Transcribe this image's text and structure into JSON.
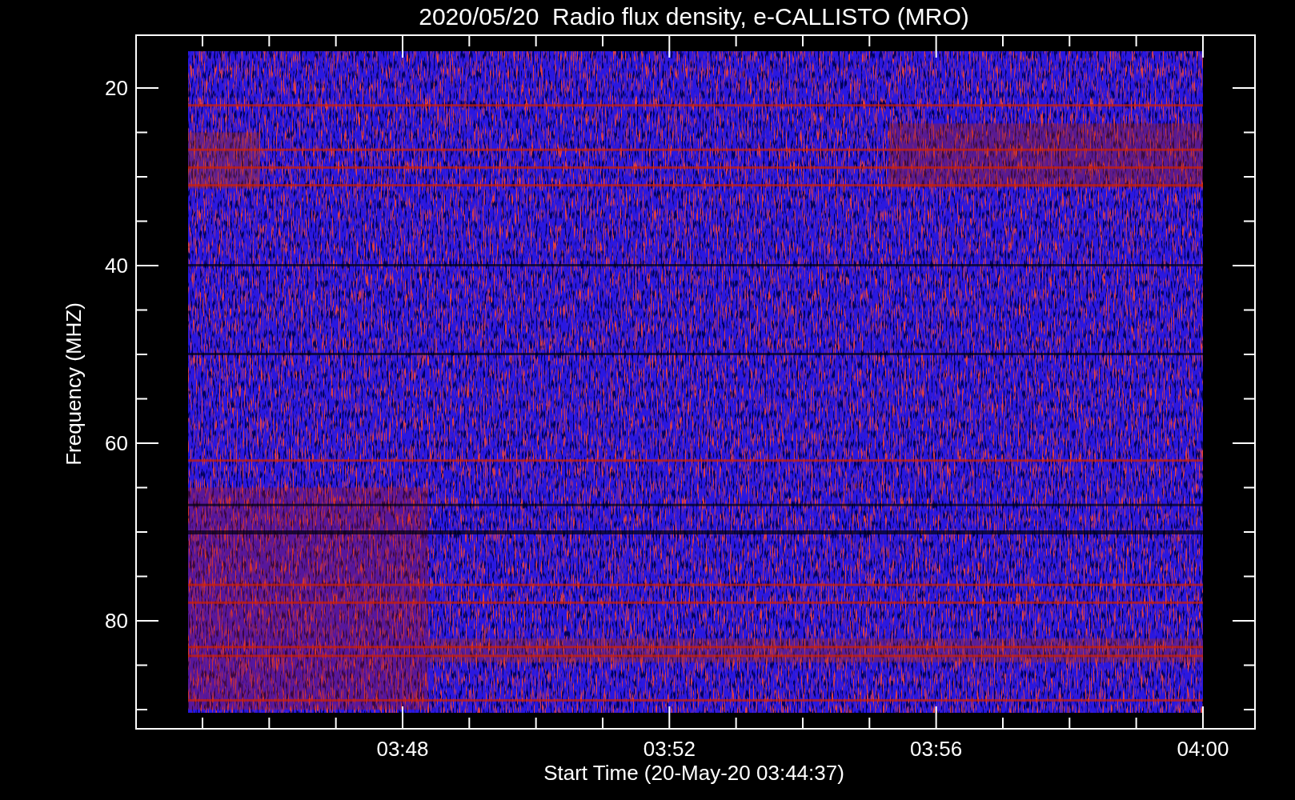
{
  "title": "2020/05/20  Radio flux density, e-CALLISTO (MRO)",
  "y_axis": {
    "label": "Frequency (MHZ)",
    "ticks": [
      "20",
      "40",
      "60",
      "80"
    ]
  },
  "x_axis": {
    "label": "Start Time (20-May-20 03:44:37)",
    "ticks": [
      "03:48",
      "03:52",
      "03:56",
      "04:00"
    ]
  }
}
